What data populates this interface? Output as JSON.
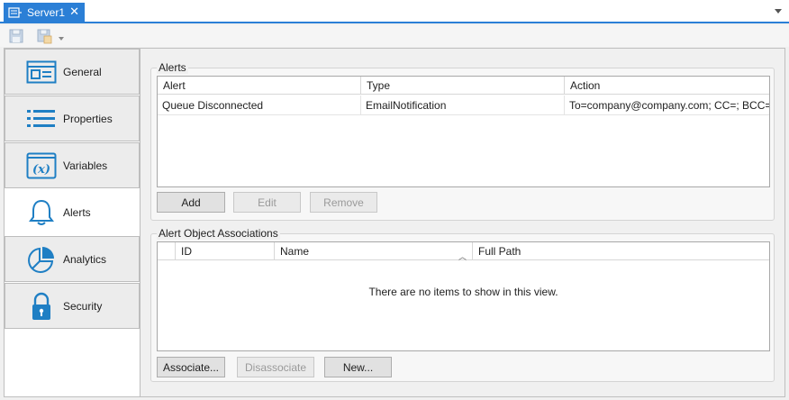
{
  "tab": {
    "title": "Server1",
    "close": "✕"
  },
  "toolbar": {
    "save_icon": "save-icon",
    "save_as_icon": "save-as-icon"
  },
  "sidebar": {
    "items": [
      {
        "label": "General",
        "icon": "general-icon"
      },
      {
        "label": "Properties",
        "icon": "properties-icon"
      },
      {
        "label": "Variables",
        "icon": "variables-icon"
      },
      {
        "label": "Alerts",
        "icon": "bell-icon",
        "active": true
      },
      {
        "label": "Analytics",
        "icon": "pie-chart-icon"
      },
      {
        "label": "Security",
        "icon": "lock-icon"
      }
    ]
  },
  "alerts": {
    "group_title": "Alerts",
    "columns": [
      "Alert",
      "Type",
      "Action"
    ],
    "rows": [
      {
        "alert": "Queue Disconnected",
        "type": "EmailNotification",
        "action": "To=company@company.com; CC=; BCC="
      }
    ],
    "buttons": {
      "add": "Add",
      "edit": "Edit",
      "remove": "Remove"
    }
  },
  "associations": {
    "group_title": "Alert Object Associations",
    "columns": [
      "ID",
      "Name",
      "Full Path"
    ],
    "empty_message": "There are no items to show in this view.",
    "buttons": {
      "associate": "Associate...",
      "disassociate": "Disassociate",
      "new": "New..."
    }
  },
  "colors": {
    "accent": "#2b7fd6",
    "icon_blue": "#1f7fc4"
  }
}
